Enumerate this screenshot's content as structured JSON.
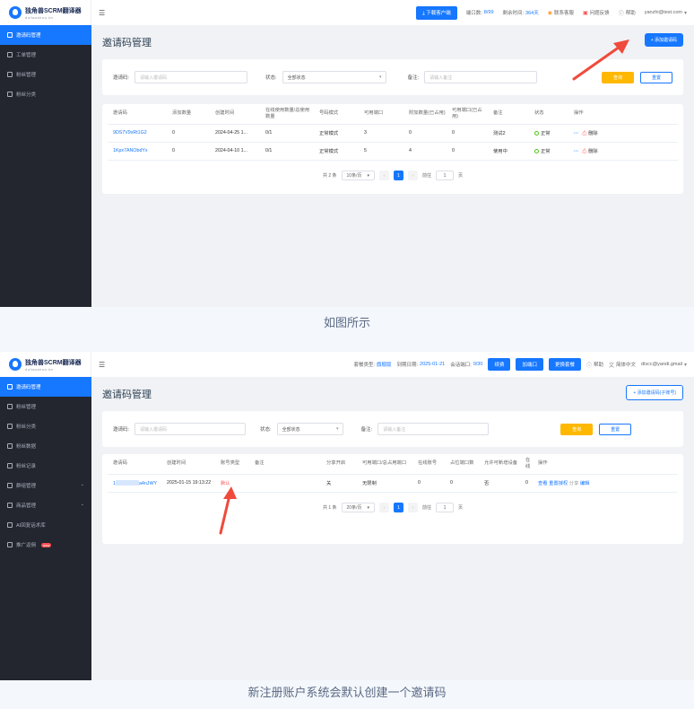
{
  "brand": {
    "name": "独角兽SCRM翻译器",
    "sub": "duliaoshou.im"
  },
  "panel1": {
    "menu": [
      {
        "label": "邀请码管理",
        "active": true
      },
      {
        "label": "工单管理"
      },
      {
        "label": "粉丝管理"
      },
      {
        "label": "粉丝分类"
      }
    ],
    "topbar": {
      "download": "下载客户端",
      "ports_label": "端口数:",
      "ports_value": "8/99",
      "days_label": "剩余时间:",
      "days_value": "364天",
      "contact": "联系客服",
      "ticket": "问题反馈",
      "help": "帮助",
      "user": "yanzhi@test.com"
    },
    "title": "邀请码管理",
    "add_button": "+ 添加邀请码",
    "filter": {
      "code_label": "邀请码:",
      "code_placeholder": "请输入邀请码",
      "status_label": "状态:",
      "status_value": "全部状态",
      "remark_label": "备注:",
      "remark_placeholder": "请输入备注",
      "search": "查询",
      "reset": "重置"
    },
    "columns": [
      "邀请码",
      "添加数量",
      "创建时间",
      "在线使用数量/总使用数量",
      "号码模式",
      "可用端口",
      "附加数量(已占用)",
      "可用端口(已占用)",
      "备注",
      "状态",
      "操作"
    ],
    "rows": [
      {
        "code": "9DS7V9xRt1G2",
        "count": "0",
        "created": "2024-04-25 1...",
        "usage": "0/1",
        "mode": "正常模式",
        "ports": "3",
        "extra": "0",
        "used": "0",
        "remark": "测试2",
        "status": "正常",
        "op": "删除"
      },
      {
        "code": "1Kpx7ANObdYx",
        "count": "0",
        "created": "2024-04-10 1...",
        "usage": "0/1",
        "mode": "正常模式",
        "ports": "5",
        "extra": "4",
        "used": "0",
        "remark": "使用中",
        "status": "正常",
        "op": "删除"
      }
    ],
    "pager": {
      "total": "共 2 条",
      "size": "10条/页",
      "page": "1",
      "goto": "前往",
      "goto_value": "1",
      "unit": "页"
    }
  },
  "caption1": "如图所示",
  "panel2": {
    "menu": [
      {
        "label": "邀请码管理",
        "active": true
      },
      {
        "label": "粉丝管理"
      },
      {
        "label": "粉丝分类"
      },
      {
        "label": "粉丝数据"
      },
      {
        "label": "粉丝记录"
      },
      {
        "label": "群组管理",
        "expand": true
      },
      {
        "label": "商品管理",
        "expand": true
      },
      {
        "label": "AI回复话术库"
      },
      {
        "label": "推广返佣",
        "badge": "new"
      }
    ],
    "topbar": {
      "type_label": "套餐类型:",
      "type_value": "旗舰版",
      "expire_label": "到期日期:",
      "expire_value": "2025-01-21",
      "ports_label": "会话端口:",
      "ports_value": "0/30",
      "renew": "续费",
      "add_port": "加端口",
      "change_plan": "更换套餐",
      "help": "帮助",
      "lang": "简体中文",
      "user": "discc@yandi.gmail"
    },
    "title": "邀请码管理",
    "add_button": "+ 添加邀请码(子账号)",
    "filter": {
      "code_label": "邀请码:",
      "code_placeholder": "请输入邀请码",
      "status_label": "状态:",
      "status_value": "全部状态",
      "remark_label": "备注:",
      "remark_placeholder": "请输入备注",
      "search": "查询",
      "reset": "重置"
    },
    "columns": [
      "邀请码",
      "创建时间",
      "账号类型",
      "备注",
      "分享开启",
      "可用端口/总占用端口",
      "在线账号",
      "占位端口数",
      "允许可新增设备",
      "在线",
      "操作"
    ],
    "row": {
      "code_prefix": "1",
      "code_suffix": "a4nJWY",
      "created": "2025-01-15 19:13:22",
      "type": "默认",
      "remark": "",
      "share": "关",
      "ports": "无限制",
      "online": "0",
      "occupied": "0",
      "allow": "否",
      "online2": "0",
      "ops": [
        "查看",
        "重置授权",
        "分享",
        "编辑"
      ]
    },
    "pager": {
      "total": "共 1 条",
      "size": "20条/页",
      "page": "1",
      "goto": "前往",
      "goto_value": "1",
      "unit": "页"
    }
  },
  "caption2": "新注册账户系统会默认创建一个邀请码",
  "colors": {
    "accent": "#1677ff",
    "sidebar": "#23262e",
    "warn": "#ffb800",
    "danger": "#ff4d4f",
    "arrow": "#f04a3c"
  }
}
